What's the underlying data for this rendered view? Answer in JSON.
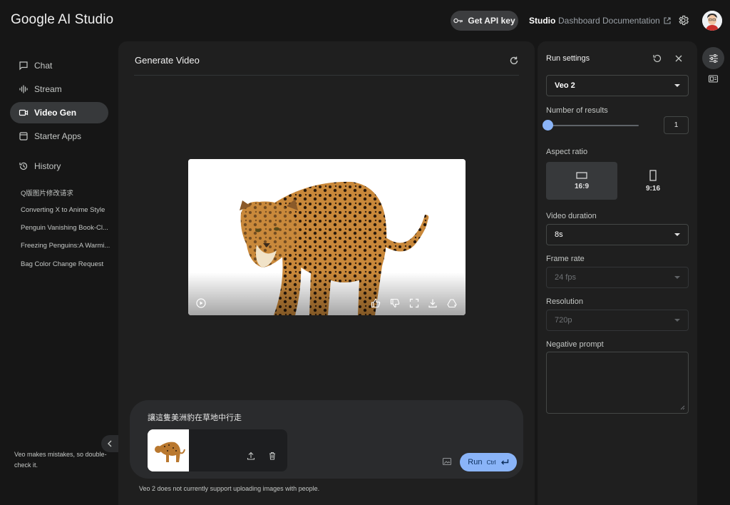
{
  "app": {
    "title": "Google AI Studio"
  },
  "header": {
    "api_key_label": "Get API key",
    "nav": {
      "studio": "Studio",
      "dashboard": "Dashboard",
      "documentation": "Documentation"
    }
  },
  "sidebar": {
    "items": [
      {
        "label": "Chat",
        "icon": "chat-icon"
      },
      {
        "label": "Stream",
        "icon": "stream-icon"
      },
      {
        "label": "Video Gen",
        "icon": "video-icon",
        "active": true
      },
      {
        "label": "Starter Apps",
        "icon": "apps-icon"
      }
    ],
    "history_label": "History",
    "history": [
      "Q版图片修改请求",
      "Converting X to Anime Style",
      "Penguin Vanishing Book-Cl...",
      "Freezing Penguins:A Warmi...",
      "Bag Color Change Request"
    ],
    "disclaimer": "Veo makes mistakes, so double-check it."
  },
  "main": {
    "title": "Generate Video",
    "prompt_text": "讓這隻美洲豹在草地中行走",
    "run_label": "Run",
    "run_shortcut": "Ctrl",
    "notice": "Veo 2 does not currently support uploading images with people."
  },
  "settings": {
    "title": "Run settings",
    "model": "Veo 2",
    "num_results_label": "Number of results",
    "num_results_value": "1",
    "aspect_label": "Aspect ratio",
    "aspect_options": [
      "16:9",
      "9:16"
    ],
    "aspect_selected": "16:9",
    "duration_label": "Video duration",
    "duration_value": "8s",
    "framerate_label": "Frame rate",
    "framerate_value": "24 fps",
    "resolution_label": "Resolution",
    "resolution_value": "720p",
    "negative_prompt_label": "Negative prompt"
  },
  "colors": {
    "accent": "#8ab4f8",
    "background": "#161616",
    "panel": "#1f1f1f"
  }
}
